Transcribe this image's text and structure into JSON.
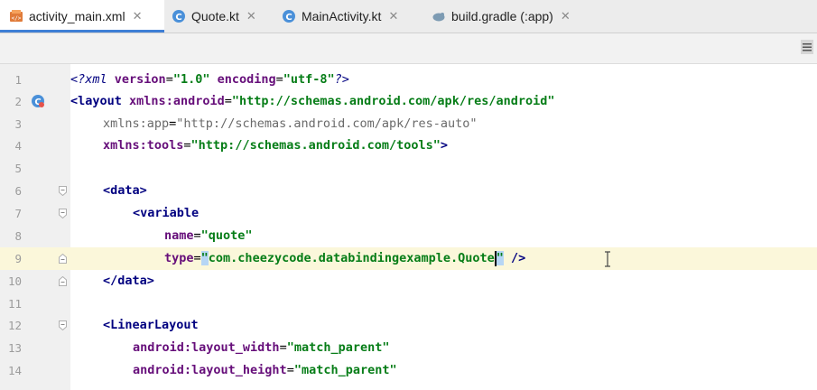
{
  "tabs": [
    {
      "label": "activity_main.xml",
      "icon": "xml-file-icon",
      "active": true
    },
    {
      "label": "Quote.kt",
      "icon": "kotlin-file-icon",
      "active": false
    },
    {
      "label": "MainActivity.kt",
      "icon": "kotlin-file-icon",
      "active": false
    },
    {
      "label": "build.gradle (:app)",
      "icon": "gradle-file-icon",
      "active": false
    }
  ],
  "close_glyph": "✕",
  "line_numbers": [
    "1",
    "2",
    "3",
    "4",
    "5",
    "6",
    "7",
    "8",
    "9",
    "10",
    "11",
    "12",
    "13",
    "14"
  ],
  "current_line": 9,
  "code": {
    "l1": {
      "pi_open": "<?",
      "pi_name": "xml",
      "a1": " version",
      "eq1": "=",
      "v1": "\"1.0\"",
      "a2": " encoding",
      "eq2": "=",
      "v2": "\"utf-8\"",
      "pi_close": "?>"
    },
    "l2": {
      "open": "<",
      "tag": "layout",
      "attr": " xmlns:android",
      "eq": "=",
      "val": "\"http://schemas.android.com/apk/res/android\""
    },
    "l3": {
      "attr": "xmlns:app",
      "eq": "=",
      "val": "\"http://schemas.android.com/apk/res-auto\""
    },
    "l4": {
      "attr": "xmlns:tools",
      "eq": "=",
      "val": "\"http://schemas.android.com/tools\"",
      "close": ">"
    },
    "l6": {
      "open": "<",
      "tag": "data",
      "close": ">"
    },
    "l7": {
      "open": "<",
      "tag": "variable"
    },
    "l8": {
      "attr": "name",
      "eq": "=",
      "val": "\"quote\""
    },
    "l9": {
      "attr": "type",
      "eq": "=",
      "q1": "\"",
      "val": "com.cheezycode.databindingexample.Quote",
      "q2": "\"",
      "close": " />"
    },
    "l10": {
      "open": "</",
      "tag": "data",
      "close": ">"
    },
    "l12": {
      "open": "<",
      "tag": "LinearLayout"
    },
    "l13": {
      "attr": "android:layout_width",
      "eq": "=",
      "val": "\"match_parent\""
    },
    "l14": {
      "attr": "android:layout_height",
      "eq": "=",
      "val": "\"match_parent\""
    }
  }
}
